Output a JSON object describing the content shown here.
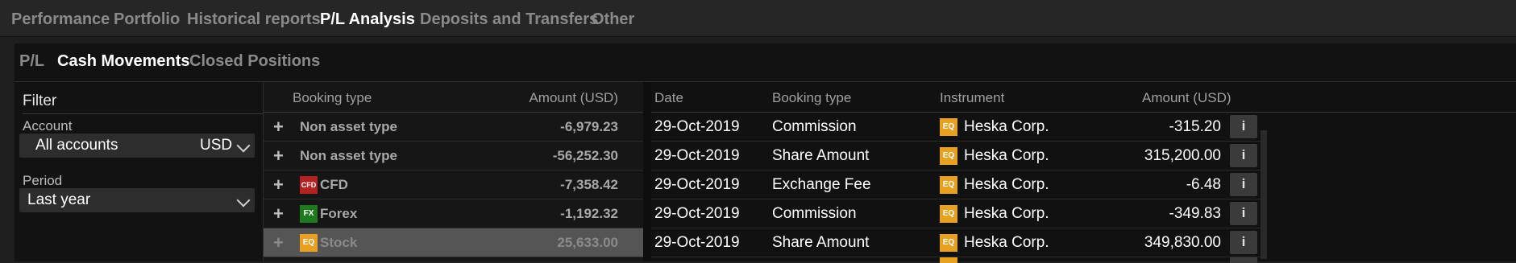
{
  "topnav": {
    "tabs": [
      {
        "label": "Performance",
        "active": false
      },
      {
        "label": "Portfolio",
        "active": false
      },
      {
        "label": "Historical reports",
        "active": false
      },
      {
        "label": "P/L Analysis",
        "active": true
      },
      {
        "label": "Deposits and Transfers",
        "active": false
      },
      {
        "label": "Other",
        "active": false
      }
    ]
  },
  "subnav": {
    "tabs": [
      {
        "label": "P/L",
        "active": false
      },
      {
        "label": "Cash Movements",
        "active": true
      },
      {
        "label": "Closed Positions",
        "active": false
      }
    ]
  },
  "filter": {
    "title": "Filter",
    "account_label": "Account",
    "account_value": "All accounts",
    "account_currency": "USD",
    "period_label": "Period",
    "period_value": "Last year"
  },
  "summary": {
    "headers": {
      "booking_type": "Booking type",
      "amount": "Amount (USD)"
    },
    "rows": [
      {
        "label": "Non asset type",
        "badge": "",
        "amount": "-6,979.23",
        "selected": false
      },
      {
        "label": "Non asset type",
        "badge": "",
        "amount": "-56,252.30",
        "selected": false
      },
      {
        "label": "CFD",
        "badge": "CFD",
        "amount": "-7,358.42",
        "selected": false
      },
      {
        "label": "Forex",
        "badge": "FX",
        "amount": "-1,192.32",
        "selected": false
      },
      {
        "label": "Stock",
        "badge": "EQ",
        "amount": "25,633.00",
        "selected": true
      }
    ]
  },
  "detail": {
    "headers": {
      "date": "Date",
      "booking_type": "Booking type",
      "instrument": "Instrument",
      "amount": "Amount (USD)"
    },
    "info_label": "i",
    "rows": [
      {
        "date": "29-Oct-2019",
        "booking_type": "Commission",
        "badge": "EQ",
        "instrument": "Heska Corp.",
        "amount": "-315.20"
      },
      {
        "date": "29-Oct-2019",
        "booking_type": "Share Amount",
        "badge": "EQ",
        "instrument": "Heska Corp.",
        "amount": "315,200.00"
      },
      {
        "date": "29-Oct-2019",
        "booking_type": "Exchange Fee",
        "badge": "EQ",
        "instrument": "Heska Corp.",
        "amount": "-6.48"
      },
      {
        "date": "29-Oct-2019",
        "booking_type": "Commission",
        "badge": "EQ",
        "instrument": "Heska Corp.",
        "amount": "-349.83"
      },
      {
        "date": "29-Oct-2019",
        "booking_type": "Share Amount",
        "badge": "EQ",
        "instrument": "Heska Corp.",
        "amount": "349,830.00"
      }
    ]
  },
  "colors": {
    "background": "#1e1e1e",
    "panel": "#121212",
    "active_text": "#ffffff",
    "inactive_text": "#8a8a8a",
    "cfd_badge": "#b22222",
    "fx_badge": "#1f7a1f",
    "eq_badge": "#e8a020",
    "selected_row": "#555555"
  }
}
